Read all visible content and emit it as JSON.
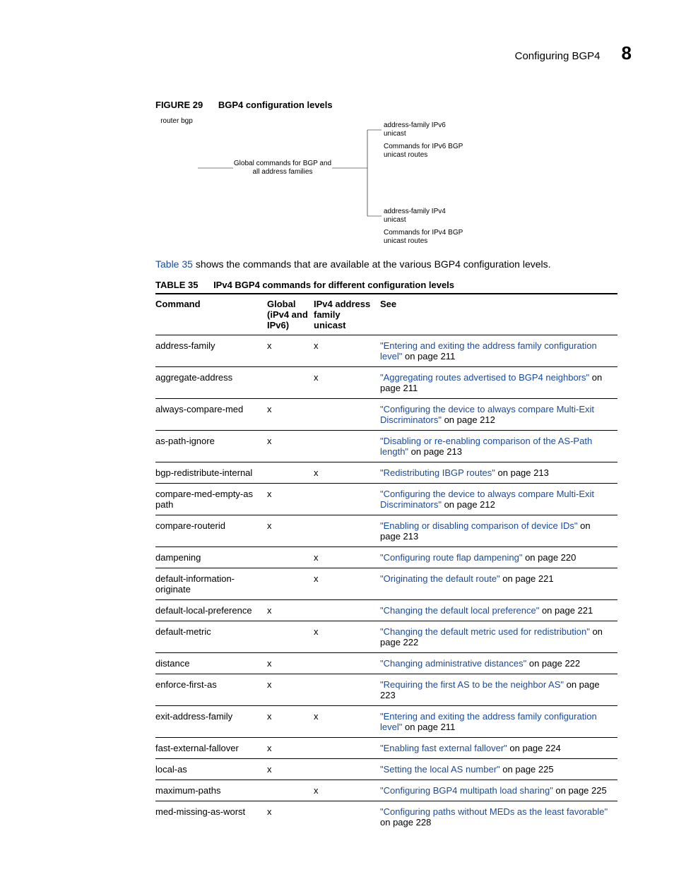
{
  "header": {
    "title": "Configuring BGP4",
    "chapter": "8"
  },
  "figure": {
    "label": "FIGURE 29",
    "text": "BGP4 configuration levels"
  },
  "diagram": {
    "router": "router bgp",
    "global": "Global commands for BGP\nand all address families",
    "af6": "address-family\nIPv6 unicast",
    "cmd6": "Commands for IPv6\nBGP unicast routes",
    "af4": "address-family\nIPv4 unicast",
    "cmd4": "Commands for IPv4\nBGP unicast routes"
  },
  "para_pre": "",
  "para_link": "Table 35",
  "para_post": " shows the commands that are available at the various BGP4 configuration levels.",
  "table_caption": {
    "label": "TABLE 35",
    "text": "IPv4 BGP4 commands for different configuration levels"
  },
  "cols": {
    "cmd": "Command",
    "glob": "Global (iPv4 and IPv6)",
    "ipv4": "IPv4 address family unicast",
    "see": "See"
  },
  "rows": [
    {
      "cmd": "address-family",
      "glob": "x",
      "ipv4": "x",
      "link": "\"Entering and exiting the address family configuration level\"",
      "suffix": " on page 211"
    },
    {
      "cmd": "aggregate-address",
      "glob": "",
      "ipv4": "x",
      "link": "\"Aggregating routes advertised to BGP4 neighbors\"",
      "suffix": " on page 211"
    },
    {
      "cmd": "always-compare-med",
      "glob": "x",
      "ipv4": "",
      "link": "\"Configuring the device to always compare Multi-Exit Discriminators\"",
      "suffix": " on page 212"
    },
    {
      "cmd": "as-path-ignore",
      "glob": "x",
      "ipv4": "",
      "link": "\"Disabling or re-enabling comparison of the AS-Path length\"",
      "suffix": " on page 213"
    },
    {
      "cmd": "bgp-redistribute-internal",
      "glob": "",
      "ipv4": "x",
      "link": "\"Redistributing IBGP routes\"",
      "suffix": " on page 213"
    },
    {
      "cmd": "compare-med-empty-as path",
      "glob": "x",
      "ipv4": "",
      "link": "\"Configuring the device to always compare Multi-Exit Discriminators\"",
      "suffix": " on page 212"
    },
    {
      "cmd": "compare-routerid",
      "glob": "x",
      "ipv4": "",
      "link": "\"Enabling or disabling comparison of device IDs\"",
      "suffix": " on page 213"
    },
    {
      "cmd": "dampening",
      "glob": "",
      "ipv4": "x",
      "link": "\"Configuring route flap dampening\"",
      "suffix": " on page 220"
    },
    {
      "cmd": "default-information-originate",
      "glob": "",
      "ipv4": "x",
      "link": "\"Originating the default route\"",
      "suffix": " on page 221"
    },
    {
      "cmd": "default-local-preference",
      "glob": "x",
      "ipv4": "",
      "link": "\"Changing the default local preference\"",
      "suffix": " on page 221"
    },
    {
      "cmd": "default-metric",
      "glob": "",
      "ipv4": "x",
      "link": "\"Changing the default metric used for redistribution\"",
      "suffix": " on page 222"
    },
    {
      "cmd": "distance",
      "glob": "x",
      "ipv4": "",
      "link": "\"Changing administrative distances\"",
      "suffix": " on page 222"
    },
    {
      "cmd": "enforce-first-as",
      "glob": "x",
      "ipv4": "",
      "link": "\"Requiring the first AS to be the neighbor AS\"",
      "suffix": " on page 223"
    },
    {
      "cmd": "exit-address-family",
      "glob": "x",
      "ipv4": "x",
      "link": "\"Entering and exiting the address family configuration level\"",
      "suffix": " on page 211"
    },
    {
      "cmd": "fast-external-fallover",
      "glob": "x",
      "ipv4": "",
      "link": "\"Enabling fast external fallover\"",
      "suffix": " on page 224"
    },
    {
      "cmd": "local-as",
      "glob": "x",
      "ipv4": "",
      "link": "\"Setting the local AS number\"",
      "suffix": " on page 225"
    },
    {
      "cmd": "maximum-paths",
      "glob": "",
      "ipv4": "x",
      "link": "\"Configuring BGP4 multipath load sharing\"",
      "suffix": " on page 225"
    },
    {
      "cmd": "med-missing-as-worst",
      "glob": "x",
      "ipv4": "",
      "link": "\"Configuring paths without MEDs as the least favorable\"",
      "suffix": " on page 228"
    }
  ]
}
